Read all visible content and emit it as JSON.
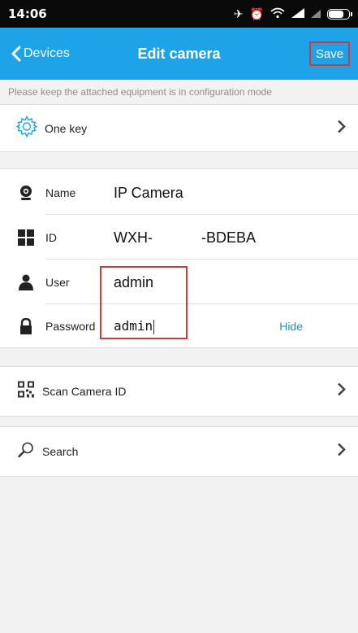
{
  "status": {
    "time": "14:06"
  },
  "nav": {
    "back_label": "Devices",
    "title": "Edit camera",
    "save_label": "Save"
  },
  "notice": "Please keep the attached equipment is in configuration mode",
  "one_key": {
    "label": "One key"
  },
  "form": {
    "name": {
      "label": "Name",
      "value": "IP Camera"
    },
    "id": {
      "label": "ID",
      "value": "WXH-",
      "suffix": "-BDEBA"
    },
    "user": {
      "label": "User",
      "value": "admin"
    },
    "password": {
      "label": "Password",
      "value": "admin",
      "toggle": "Hide"
    }
  },
  "scan": {
    "label": "Scan Camera ID"
  },
  "search": {
    "label": "Search"
  },
  "colors": {
    "accent": "#1fa3e8",
    "highlight": "#d8373a",
    "link": "#1f8fd6"
  }
}
